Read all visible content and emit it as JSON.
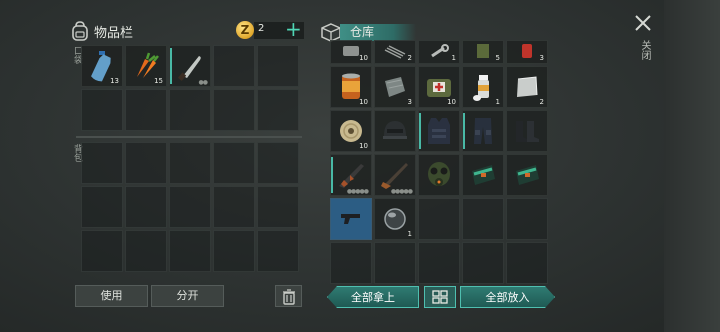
{
  "inventory": {
    "title": "物品栏",
    "pocket_label": "口袋",
    "backpack_label": "背包"
  },
  "currency": {
    "amount": "2",
    "coin_symbol": "Z",
    "add_symbol": "+"
  },
  "warehouse": {
    "title": "仓库"
  },
  "close": {
    "label": "关闭"
  },
  "pocket_items": [
    {
      "icon": "water-bottle-icon",
      "count": "13"
    },
    {
      "icon": "carrot-icon",
      "count": "15"
    },
    {
      "icon": "machete-icon",
      "durability": "●●"
    }
  ],
  "warehouse_items": {
    "top_row": [
      {
        "icon": "metal-part-icon",
        "count": "10"
      },
      {
        "icon": "spring-icon",
        "count": "2"
      },
      {
        "icon": "wrench-icon",
        "count": "1"
      },
      {
        "icon": "jerrycan-icon",
        "count": "5"
      },
      {
        "icon": "red-canister-icon",
        "count": "3"
      }
    ],
    "rows": [
      [
        {
          "icon": "canned-food-icon",
          "count": "10"
        },
        {
          "icon": "cloth-icon",
          "count": "3"
        },
        {
          "icon": "first-aid-bag-icon",
          "count": "10"
        },
        {
          "icon": "pills-bottle-icon",
          "count": "1"
        },
        {
          "icon": "metal-sheet-icon",
          "count": "2"
        }
      ],
      [
        {
          "icon": "rope-spool-icon",
          "count": "10"
        },
        {
          "icon": "tactical-helmet-icon"
        },
        {
          "icon": "body-armor-icon"
        },
        {
          "icon": "tactical-pants-icon"
        },
        {
          "icon": "combat-boots-icon"
        }
      ],
      [
        {
          "icon": "assault-rifle-icon",
          "durability": "●●●●●"
        },
        {
          "icon": "hunting-rifle-icon",
          "durability": "●●●●●"
        },
        {
          "icon": "gas-mask-icon"
        },
        {
          "icon": "supply-bag-icon"
        },
        {
          "icon": "supply-bag-icon"
        }
      ],
      [
        {
          "icon": "blueprint-icon"
        },
        {
          "icon": "glass-lens-icon",
          "count": "1"
        }
      ]
    ]
  },
  "buttons": {
    "use": "使用",
    "split": "分开",
    "take_all": "全部拿上",
    "put_all": "全部放入"
  },
  "colors": {
    "accent": "#49b9a6",
    "coin": "#e0a72a",
    "button_teal": "#2f7b72"
  }
}
